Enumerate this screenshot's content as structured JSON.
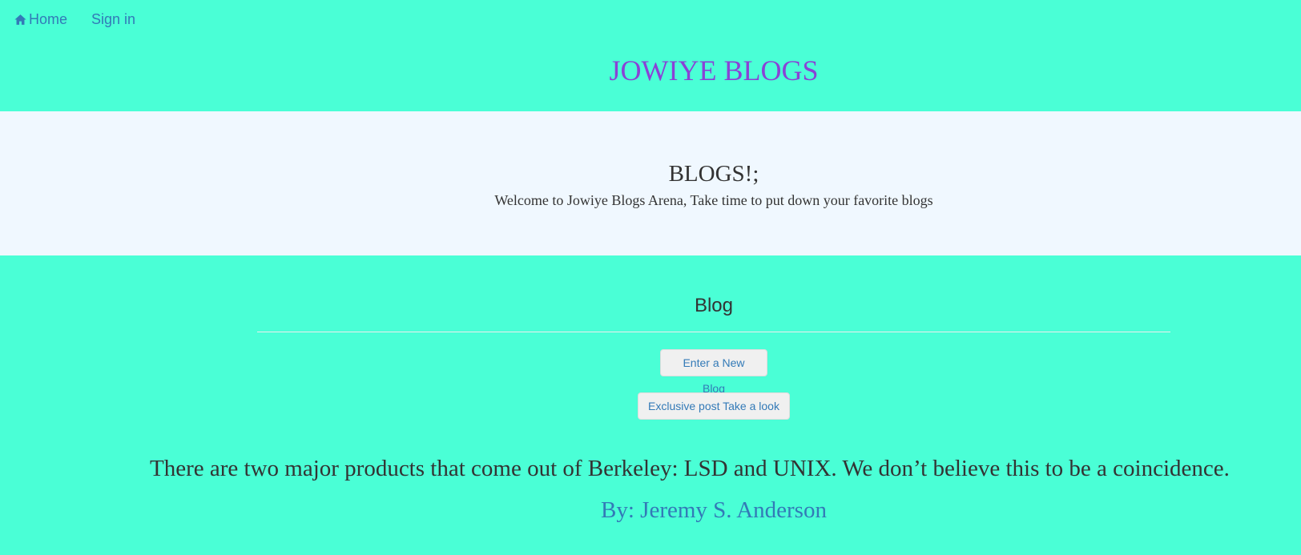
{
  "nav": {
    "home_label": "Home",
    "home_icon": "home-icon",
    "signin_label": "Sign in"
  },
  "header": {
    "title": "JOWIYE BLOGS"
  },
  "hero": {
    "title": "BLOGS!;",
    "subtitle": "Welcome to Jowiye Blogs Arena, Take time to put down your favorite blogs"
  },
  "blog": {
    "heading": "Blog",
    "new_blog_button": "Enter a New Blog",
    "exclusive_button": "Exclusive post Take a look"
  },
  "quote": {
    "text": "There are two major products that come out of Berkeley: LSD and UNIX. We don’t believe this to be a coincidence.",
    "author": "By: Jeremy S. Anderson"
  },
  "colors": {
    "page_background": "#4affd6",
    "hero_background": "#f0f8ff",
    "title_color": "#8a42d6",
    "link_color": "#337ab7",
    "text_color": "#333333"
  }
}
